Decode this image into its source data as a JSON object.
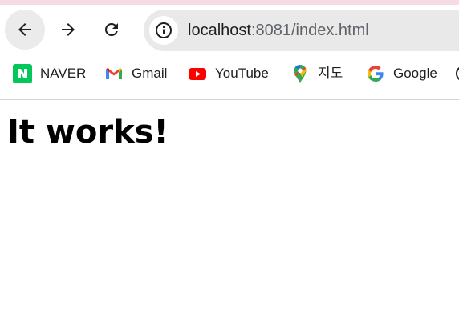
{
  "omnibox": {
    "url_host": "localhost",
    "url_rest": ":8081/index.html"
  },
  "bookmarks": [
    {
      "label": "NAVER",
      "icon": "naver-icon"
    },
    {
      "label": "Gmail",
      "icon": "gmail-icon"
    },
    {
      "label": "YouTube",
      "icon": "youtube-icon"
    },
    {
      "label": "지도",
      "icon": "maps-icon"
    },
    {
      "label": "Google",
      "icon": "google-icon"
    }
  ],
  "page": {
    "heading": "It works!"
  },
  "colors": {
    "naver": "#03c75a",
    "youtube": "#ff0000",
    "omnibox_bg": "#e9e9e9"
  }
}
